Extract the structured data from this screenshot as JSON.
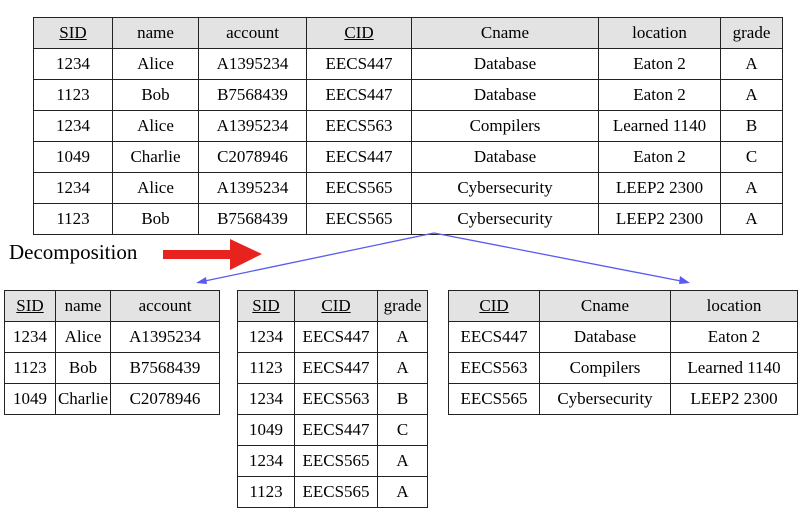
{
  "decomposition_label": "Decomposition",
  "colors": {
    "arrow": "#e8231f",
    "connector": "#5a5aef",
    "header_bg": "#e3e3e3"
  },
  "main_table": {
    "headers": [
      {
        "text": "SID",
        "key": true
      },
      {
        "text": "name",
        "key": false
      },
      {
        "text": "account",
        "key": false
      },
      {
        "text": "CID",
        "key": true
      },
      {
        "text": "Cname",
        "key": false
      },
      {
        "text": "location",
        "key": false
      },
      {
        "text": "grade",
        "key": false
      }
    ],
    "rows": [
      [
        "1234",
        "Alice",
        "A1395234",
        "EECS447",
        "Database",
        "Eaton 2",
        "A"
      ],
      [
        "1123",
        "Bob",
        "B7568439",
        "EECS447",
        "Database",
        "Eaton 2",
        "A"
      ],
      [
        "1234",
        "Alice",
        "A1395234",
        "EECS563",
        "Compilers",
        "Learned 1140",
        "B"
      ],
      [
        "1049",
        "Charlie",
        "C2078946",
        "EECS447",
        "Database",
        "Eaton 2",
        "C"
      ],
      [
        "1234",
        "Alice",
        "A1395234",
        "EECS565",
        "Cybersecurity",
        "LEEP2 2300",
        "A"
      ],
      [
        "1123",
        "Bob",
        "B7568439",
        "EECS565",
        "Cybersecurity",
        "LEEP2 2300",
        "A"
      ]
    ]
  },
  "student_table": {
    "headers": [
      {
        "text": "SID",
        "key": true
      },
      {
        "text": "name",
        "key": false
      },
      {
        "text": "account",
        "key": false
      }
    ],
    "rows": [
      [
        "1234",
        "Alice",
        "A1395234"
      ],
      [
        "1123",
        "Bob",
        "B7568439"
      ],
      [
        "1049",
        "Charlie",
        "C2078946"
      ]
    ]
  },
  "enroll_table": {
    "headers": [
      {
        "text": "SID",
        "key": true
      },
      {
        "text": "CID",
        "key": true
      },
      {
        "text": "grade",
        "key": false
      }
    ],
    "rows": [
      [
        "1234",
        "EECS447",
        "A"
      ],
      [
        "1123",
        "EECS447",
        "A"
      ],
      [
        "1234",
        "EECS563",
        "B"
      ],
      [
        "1049",
        "EECS447",
        "C"
      ],
      [
        "1234",
        "EECS565",
        "A"
      ],
      [
        "1123",
        "EECS565",
        "A"
      ]
    ]
  },
  "course_table": {
    "headers": [
      {
        "text": "CID",
        "key": true
      },
      {
        "text": "Cname",
        "key": false
      },
      {
        "text": "location",
        "key": false
      }
    ],
    "rows": [
      [
        "EECS447",
        "Database",
        "Eaton 2"
      ],
      [
        "EECS563",
        "Compilers",
        "Learned 1140"
      ],
      [
        "EECS565",
        "Cybersecurity",
        "LEEP2 2300"
      ]
    ]
  }
}
